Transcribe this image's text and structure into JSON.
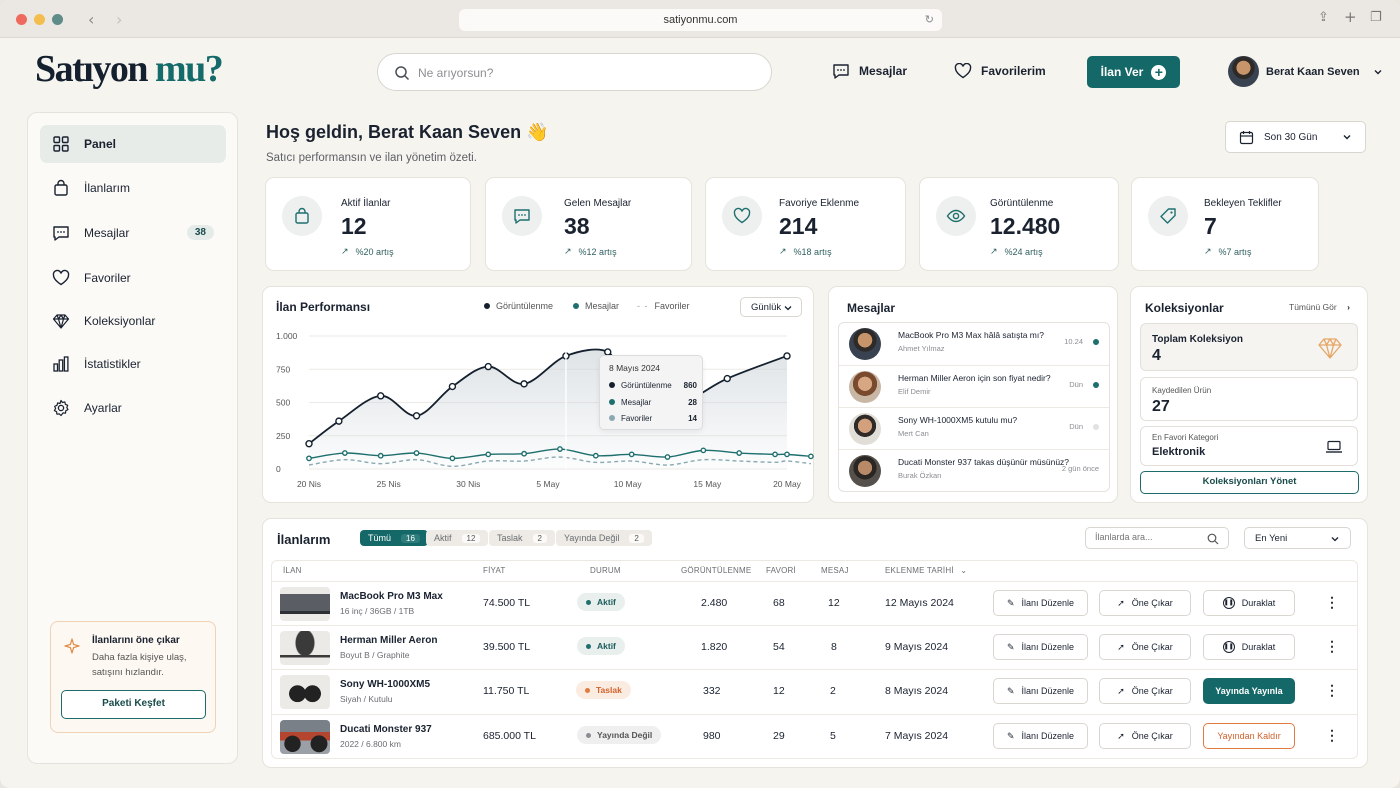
{
  "browser": {
    "url": "satiyonmu.com"
  },
  "header": {
    "logo_main": "Satıyon",
    "logo_accent": "mu?",
    "search_placeholder": "Ne arıyorsun?",
    "messages_label": "Mesajlar",
    "favorites_label": "Favorilerim",
    "post_ad_label": "İlan Ver",
    "user_name": "Berat Kaan Seven"
  },
  "sidebar": {
    "items": [
      {
        "label": "Panel",
        "icon": "grid-icon"
      },
      {
        "label": "İlanlarım",
        "icon": "bag-icon"
      },
      {
        "label": "Mesajlar",
        "icon": "chat-icon",
        "badge": "38"
      },
      {
        "label": "Favoriler",
        "icon": "heart-icon"
      },
      {
        "label": "Koleksiyonlar",
        "icon": "diamond-icon"
      },
      {
        "label": "İstatistikler",
        "icon": "bar-chart-icon"
      },
      {
        "label": "Ayarlar",
        "icon": "gear-icon"
      }
    ],
    "promo": {
      "title": "İlanlarını öne çıkar",
      "text": "Daha fazla kişiye ulaş, satışını hızlandır.",
      "button": "Paketi Keşfet"
    }
  },
  "welcome": {
    "title": "Hoş geldin, Berat Kaan Seven 👋",
    "subtitle": "Satıcı performansın ve ilan yönetim özeti.",
    "date_filter": "Son 30 Gün"
  },
  "stats": [
    {
      "label": "Aktif İlanlar",
      "value": "12",
      "delta": "%20 artış"
    },
    {
      "label": "Gelen Mesajlar",
      "value": "38",
      "delta": "%12 artış"
    },
    {
      "label": "Favoriye Eklenme",
      "value": "214",
      "delta": "%18 artış"
    },
    {
      "label": "Görüntülenme",
      "value": "12.480",
      "delta": "%24 artış"
    },
    {
      "label": "Bekleyen Teklifler",
      "value": "7",
      "delta": "%7 artış"
    }
  ],
  "performance": {
    "title": "İlan Performansı",
    "period": "Günlük",
    "legend": [
      "Görüntülenme",
      "Mesajlar",
      "Favoriler"
    ],
    "tooltip": {
      "date": "8 Mayıs 2024",
      "rows": [
        {
          "label": "Görüntülenme",
          "value": "860"
        },
        {
          "label": "Mesajlar",
          "value": "28"
        },
        {
          "label": "Favoriler",
          "value": "14"
        }
      ]
    }
  },
  "chart_data": {
    "type": "line",
    "title": "İlan Performansı",
    "x_ticks": [
      "20 Nis",
      "25 Nis",
      "30 Nis",
      "5 May",
      "10 May",
      "15 May",
      "20 May"
    ],
    "y_ticks": [
      "0",
      "250",
      "500",
      "750",
      "1.000"
    ],
    "ylim": [
      0,
      1000
    ],
    "legend_position": "top-right",
    "grid": true,
    "x": [
      0,
      1,
      2,
      3,
      4,
      5,
      6,
      7,
      8,
      9,
      10,
      11,
      12,
      13,
      14,
      15,
      16,
      17,
      18,
      19,
      20,
      21,
      22,
      23,
      24,
      25,
      26,
      27,
      28,
      29,
      30
    ],
    "series": [
      {
        "name": "Görüntülenme",
        "color": "#14202e",
        "dash": "none",
        "values": [
          190,
          360,
          550,
          400,
          620,
          770,
          640,
          850,
          880,
          620,
          480,
          680,
          850
        ]
      },
      {
        "name": "Mesajlar",
        "color": "#1e6f6e",
        "dash": "none",
        "values": [
          80,
          120,
          100,
          120,
          80,
          110,
          115,
          150,
          100,
          110,
          90,
          140,
          120,
          110,
          95,
          110
        ]
      },
      {
        "name": "Favoriler",
        "color": "#8aa9b0",
        "dash": "dashed",
        "values": [
          30,
          70,
          40,
          70,
          20,
          60,
          60,
          90,
          50,
          60,
          30,
          70,
          60,
          50,
          40,
          60
        ]
      }
    ],
    "series_x": {
      "Görüntülenme": [
        0,
        2.5,
        6,
        9,
        12,
        15,
        18,
        21.5,
        25,
        26.5,
        30.5,
        35,
        40
      ],
      "Mesajlar": [
        0,
        3,
        6,
        9,
        12,
        15,
        18,
        21,
        24,
        27,
        30,
        33,
        36,
        39,
        42,
        40
      ],
      "Favoriler": [
        0,
        3,
        6,
        9,
        12,
        15,
        18,
        21,
        24,
        27,
        30,
        33,
        36,
        39,
        42,
        40
      ]
    }
  },
  "messages": {
    "title": "Mesajlar",
    "items": [
      {
        "text": "MacBook Pro M3 Max hâlâ satışta mı?",
        "from": "Ahmet Yılmaz",
        "time": "10.24",
        "unread": true
      },
      {
        "text": "Herman Miller Aeron için son fiyat nedir?",
        "from": "Elif Demir",
        "time": "Dün",
        "unread": true
      },
      {
        "text": "Sony WH-1000XM5 kutulu mu?",
        "from": "Mert Can",
        "time": "Dün",
        "unread": false
      },
      {
        "text": "Ducati Monster 937 takas düşünür müsünüz?",
        "from": "Burak Özkan",
        "time": "2 gün önce",
        "unread": false
      }
    ]
  },
  "collections": {
    "title": "Koleksiyonlar",
    "see_all": "Tümünü Gör",
    "total_label": "Toplam Koleksiyon",
    "total_value": "4",
    "saved_label": "Kaydedilen Ürün",
    "saved_value": "27",
    "fav_cat_label": "En Favori Kategori",
    "fav_cat_value": "Elektronik",
    "manage_button": "Koleksiyonları Yönet"
  },
  "listings": {
    "title": "İlanlarım",
    "tabs": [
      {
        "label": "Tümü",
        "count": "16"
      },
      {
        "label": "Aktif",
        "count": "12"
      },
      {
        "label": "Taslak",
        "count": "2"
      },
      {
        "label": "Yayında Değil",
        "count": "2"
      }
    ],
    "search_placeholder": "İlanlarda ara...",
    "sort": "En Yeni",
    "columns": [
      "İLAN",
      "FİYAT",
      "DURUM",
      "GÖRÜNTÜLENME",
      "FAVORİ",
      "MESAJ",
      "EKLENME TARİHİ"
    ],
    "rows": [
      {
        "name": "MacBook Pro M3 Max",
        "spec": "16 inç / 36GB / 1TB",
        "price": "74.500 TL",
        "status": "Aktif",
        "views": "2.480",
        "favs": "68",
        "msgs": "12",
        "date": "12 Mayıs 2024",
        "edit": "İlanı Düzenle",
        "boost": "Öne Çıkar",
        "action": "Duraklat"
      },
      {
        "name": "Herman Miller Aeron",
        "spec": "Boyut B / Graphite",
        "price": "39.500 TL",
        "status": "Aktif",
        "views": "1.820",
        "favs": "54",
        "msgs": "8",
        "date": "9 Mayıs 2024",
        "edit": "İlanı Düzenle",
        "boost": "Öne Çıkar",
        "action": "Duraklat"
      },
      {
        "name": "Sony WH-1000XM5",
        "spec": "Siyah / Kutulu",
        "price": "11.750 TL",
        "status": "Taslak",
        "views": "332",
        "favs": "12",
        "msgs": "2",
        "date": "8 Mayıs 2024",
        "edit": "İlanı Düzenle",
        "boost": "Öne Çıkar",
        "action": "Yayında Yayınla"
      },
      {
        "name": "Ducati Monster 937",
        "spec": "2022 / 6.800 km",
        "price": "685.000 TL",
        "status": "Yayında Değil",
        "views": "980",
        "favs": "29",
        "msgs": "5",
        "date": "7 Mayıs 2024",
        "edit": "İlanı Düzenle",
        "boost": "Öne Çıkar",
        "action": "Yayından Kaldır"
      }
    ]
  },
  "colors": {
    "accent": "#156868",
    "dark": "#14202e",
    "draft": "#e07a3f",
    "off": "#8a8d92"
  }
}
